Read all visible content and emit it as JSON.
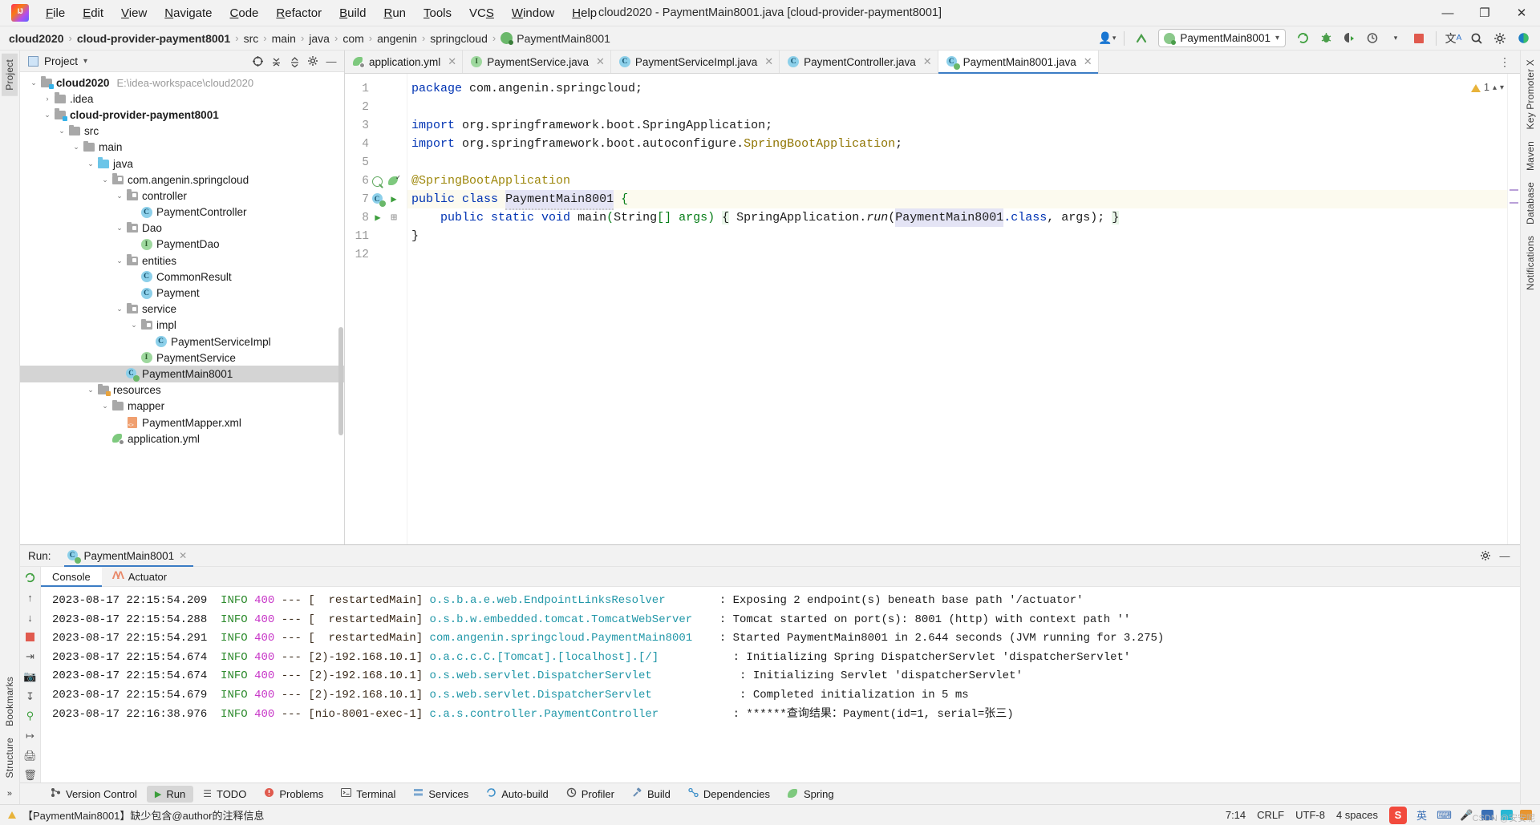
{
  "titlebar": {
    "logo": "intellij-idea-logo",
    "window_title": "cloud2020 - PaymentMain8001.java [cloud-provider-payment8001]",
    "menus": [
      "File",
      "Edit",
      "View",
      "Navigate",
      "Code",
      "Refactor",
      "Build",
      "Run",
      "Tools",
      "VCS",
      "Window",
      "Help"
    ],
    "minimize": "—",
    "maximize": "❐",
    "close": "✕"
  },
  "navbar": {
    "crumbs": [
      {
        "label": "cloud2020",
        "bold": true,
        "icon": null
      },
      {
        "label": "cloud-provider-payment8001",
        "bold": true,
        "icon": null
      },
      {
        "label": "src",
        "bold": false,
        "icon": null
      },
      {
        "label": "main",
        "bold": false,
        "icon": null
      },
      {
        "label": "java",
        "bold": false,
        "icon": null
      },
      {
        "label": "com",
        "bold": false,
        "icon": null
      },
      {
        "label": "angenin",
        "bold": false,
        "icon": null
      },
      {
        "label": "springcloud",
        "bold": false,
        "icon": null
      },
      {
        "label": "PaymentMain8001",
        "bold": false,
        "icon": "spring-class-icon"
      }
    ],
    "separator": "›",
    "run_config": "PaymentMain8001",
    "run_config_caret": "▾",
    "toolbar_icons": [
      "profile-user-icon",
      "chevron-down-icon",
      "up-arrow-icon",
      "rerun-icon",
      "debug-icon",
      "run-with-coverage-icon",
      "profiler-icon",
      "chevron-down-icon",
      "stop-icon",
      "translate-icon",
      "search-icon",
      "settings-gear-icon",
      "theme-icon"
    ]
  },
  "left_strip": [
    {
      "label": "Project",
      "selected": true
    },
    {
      "label": "Bookmarks",
      "selected": false
    },
    {
      "label": "Structure",
      "selected": false
    }
  ],
  "right_strip": [
    {
      "label": "Key Promoter X"
    },
    {
      "label": "Maven"
    },
    {
      "label": "Database"
    },
    {
      "label": "Notifications"
    }
  ],
  "project": {
    "title": "Project",
    "caret": "▾",
    "header_icons": [
      "locate-icon",
      "collapse-all-icon",
      "expand-all-icon",
      "settings-gear-icon",
      "hide-icon"
    ],
    "tree": [
      {
        "depth": 0,
        "arrow": "⌄",
        "icon": "module-folder-icon",
        "label": "cloud2020",
        "bold": true,
        "path": "E:\\idea-workspace\\cloud2020",
        "selected": false
      },
      {
        "depth": 1,
        "arrow": "›",
        "icon": "folder-icon",
        "label": ".idea",
        "bold": false,
        "path": "",
        "selected": false
      },
      {
        "depth": 1,
        "arrow": "⌄",
        "icon": "module-folder-icon",
        "label": "cloud-provider-payment8001",
        "bold": true,
        "path": "",
        "selected": false
      },
      {
        "depth": 2,
        "arrow": "⌄",
        "icon": "folder-icon",
        "label": "src",
        "bold": false,
        "path": "",
        "selected": false
      },
      {
        "depth": 3,
        "arrow": "⌄",
        "icon": "folder-icon",
        "label": "main",
        "bold": false,
        "path": "",
        "selected": false
      },
      {
        "depth": 4,
        "arrow": "⌄",
        "icon": "source-folder-icon",
        "label": "java",
        "bold": false,
        "path": "",
        "selected": false
      },
      {
        "depth": 5,
        "arrow": "⌄",
        "icon": "package-icon",
        "label": "com.angenin.springcloud",
        "bold": false,
        "path": "",
        "selected": false
      },
      {
        "depth": 6,
        "arrow": "⌄",
        "icon": "package-icon",
        "label": "controller",
        "bold": false,
        "path": "",
        "selected": false
      },
      {
        "depth": 7,
        "arrow": "",
        "icon": "java-class-icon",
        "label": "PaymentController",
        "bold": false,
        "path": "",
        "selected": false
      },
      {
        "depth": 6,
        "arrow": "⌄",
        "icon": "package-icon",
        "label": "Dao",
        "bold": false,
        "path": "",
        "selected": false
      },
      {
        "depth": 7,
        "arrow": "",
        "icon": "java-interface-icon",
        "label": "PaymentDao",
        "bold": false,
        "path": "",
        "selected": false
      },
      {
        "depth": 6,
        "arrow": "⌄",
        "icon": "package-icon",
        "label": "entities",
        "bold": false,
        "path": "",
        "selected": false
      },
      {
        "depth": 7,
        "arrow": "",
        "icon": "java-class-icon",
        "label": "CommonResult",
        "bold": false,
        "path": "",
        "selected": false
      },
      {
        "depth": 7,
        "arrow": "",
        "icon": "java-class-icon",
        "label": "Payment",
        "bold": false,
        "path": "",
        "selected": false
      },
      {
        "depth": 6,
        "arrow": "⌄",
        "icon": "package-icon",
        "label": "service",
        "bold": false,
        "path": "",
        "selected": false
      },
      {
        "depth": 7,
        "arrow": "⌄",
        "icon": "package-icon",
        "label": "impl",
        "bold": false,
        "path": "",
        "selected": false
      },
      {
        "depth": 8,
        "arrow": "",
        "icon": "java-class-icon",
        "label": "PaymentServiceImpl",
        "bold": false,
        "path": "",
        "selected": false
      },
      {
        "depth": 7,
        "arrow": "",
        "icon": "java-interface-icon",
        "label": "PaymentService",
        "bold": false,
        "path": "",
        "selected": false
      },
      {
        "depth": 6,
        "arrow": "",
        "icon": "spring-class-icon",
        "label": "PaymentMain8001",
        "bold": false,
        "path": "",
        "selected": true
      },
      {
        "depth": 4,
        "arrow": "⌄",
        "icon": "resource-folder-icon",
        "label": "resources",
        "bold": false,
        "path": "",
        "selected": false
      },
      {
        "depth": 5,
        "arrow": "⌄",
        "icon": "folder-icon",
        "label": "mapper",
        "bold": false,
        "path": "",
        "selected": false
      },
      {
        "depth": 6,
        "arrow": "",
        "icon": "xml-file-icon",
        "label": "PaymentMapper.xml",
        "bold": false,
        "path": "",
        "selected": false
      },
      {
        "depth": 5,
        "arrow": "",
        "icon": "yaml-spring-icon",
        "label": "application.yml",
        "bold": false,
        "path": "",
        "selected": false
      }
    ]
  },
  "editor": {
    "tabs": [
      {
        "label": "application.yml",
        "icon": "yaml-spring-icon",
        "active": false,
        "close": "✕"
      },
      {
        "label": "PaymentService.java",
        "icon": "java-interface-icon",
        "active": false,
        "close": "✕"
      },
      {
        "label": "PaymentServiceImpl.java",
        "icon": "java-class-icon",
        "active": false,
        "close": "✕"
      },
      {
        "label": "PaymentController.java",
        "icon": "java-class-icon",
        "active": false,
        "close": "✕"
      },
      {
        "label": "PaymentMain8001.java",
        "icon": "spring-class-icon",
        "active": true,
        "close": "✕"
      }
    ],
    "tabbar_more": "⋮",
    "warning_count": "1",
    "inspection_icons": [
      "warning-triangle-icon",
      "chevron-up-icon",
      "chevron-down-icon"
    ],
    "lines": [
      {
        "num": "1",
        "gutter": [],
        "fold": "",
        "highlight": false
      },
      {
        "num": "2",
        "gutter": [],
        "fold": "",
        "highlight": false
      },
      {
        "num": "3",
        "gutter": [],
        "fold": "import-fold",
        "highlight": false
      },
      {
        "num": "4",
        "gutter": [],
        "fold": "import-fold-end",
        "highlight": false
      },
      {
        "num": "5",
        "gutter": [],
        "fold": "",
        "highlight": false
      },
      {
        "num": "6",
        "gutter": [
          "spring-bean-icon",
          "spring-leaf-check-icon"
        ],
        "fold": "",
        "highlight": false
      },
      {
        "num": "7",
        "gutter": [
          "spring-class-icon",
          "run-arrow-icon"
        ],
        "fold": "",
        "highlight": true
      },
      {
        "num": "8",
        "gutter": [
          "run-arrow-icon"
        ],
        "fold": "method-fold",
        "highlight": false
      },
      {
        "num": "11",
        "gutter": [],
        "fold": "",
        "highlight": false
      },
      {
        "num": "12",
        "gutter": [],
        "fold": "",
        "highlight": false
      }
    ],
    "code": {
      "line1_kw": "package",
      "line1_rest": " com.angenin.springcloud;",
      "line3_kw": "import",
      "line3_rest": " org.springframework.boot.SpringApplication;",
      "line4_kw": "import",
      "line4_mid": " org.springframework.boot.autoconfigure.",
      "line4_cls": "SpringBootApplication",
      "line4_end": ";",
      "line6_ann": "@SpringBootApplication",
      "line7_kw1": "public",
      "line7_kw2": "class",
      "line7_name": "PaymentMain8001",
      "line7_brace": "{",
      "line8_kw": "public static void",
      "line8_main": "main",
      "line8_p1": "(",
      "line8_type": "String",
      "line8_p2": "[] args)",
      "line8_brace1": "{",
      "line8_app": "SpringApplication.",
      "line8_run": "run",
      "line8_p3": "(",
      "line8_arg": "PaymentMain8001",
      "line8_cls": ".class",
      "line8_p4": ", args);",
      "line8_brace2": "}",
      "line11_brace": "}"
    }
  },
  "run_panel": {
    "label": "Run:",
    "tab_title": "PaymentMain8001",
    "tab_close": "✕",
    "tab_icon": "spring-run-icon",
    "header_icons": [
      "settings-gear-icon",
      "hide-icon"
    ],
    "sidebar_icons": [
      "rerun-icon",
      "scroll-up-icon",
      "scroll-down-icon",
      "stop-icon",
      "soft-wrap-icon",
      "camera-icon",
      "scroll-end-icon",
      "thread-dump-icon",
      "export-icon",
      "print-icon",
      "trash-icon"
    ],
    "subtabs": [
      {
        "label": "Console",
        "icon": null,
        "active": true
      },
      {
        "label": "Actuator",
        "icon": "actuator-icon",
        "active": false
      }
    ],
    "logs": [
      {
        "ts": "2023-08-17 22:15:54.209",
        "level": "INFO",
        "pid": "400",
        "dash": "---",
        "thread": "[  restartedMain]",
        "logger": "o.s.b.a.e.web.EndpointLinksResolver",
        "msg": ": Exposing 2 endpoint(s) beneath base path '/actuator'"
      },
      {
        "ts": "2023-08-17 22:15:54.288",
        "level": "INFO",
        "pid": "400",
        "dash": "---",
        "thread": "[  restartedMain]",
        "logger": "o.s.b.w.embedded.tomcat.TomcatWebServer",
        "msg": ": Tomcat started on port(s): 8001 (http) with context path ''"
      },
      {
        "ts": "2023-08-17 22:15:54.291",
        "level": "INFO",
        "pid": "400",
        "dash": "---",
        "thread": "[  restartedMain]",
        "logger": "com.angenin.springcloud.PaymentMain8001",
        "msg": ": Started PaymentMain8001 in 2.644 seconds (JVM running for 3.275)"
      },
      {
        "ts": "2023-08-17 22:15:54.674",
        "level": "INFO",
        "pid": "400",
        "dash": "---",
        "thread": "[2)-192.168.10.1]",
        "logger": "o.a.c.c.C.[Tomcat].[localhost].[/]",
        "msg": ": Initializing Spring DispatcherServlet 'dispatcherServlet'"
      },
      {
        "ts": "2023-08-17 22:15:54.674",
        "level": "INFO",
        "pid": "400",
        "dash": "---",
        "thread": "[2)-192.168.10.1]",
        "logger": "o.s.web.servlet.DispatcherServlet",
        "msg": ": Initializing Servlet 'dispatcherServlet'"
      },
      {
        "ts": "2023-08-17 22:15:54.679",
        "level": "INFO",
        "pid": "400",
        "dash": "---",
        "thread": "[2)-192.168.10.1]",
        "logger": "o.s.web.servlet.DispatcherServlet",
        "msg": ": Completed initialization in 5 ms"
      },
      {
        "ts": "2023-08-17 22:16:38.976",
        "level": "INFO",
        "pid": "400",
        "dash": "---",
        "thread": "[nio-8001-exec-1]",
        "logger": "c.a.s.controller.PaymentController",
        "msg": ": ******查询结果：Payment(id=1, serial=张三)"
      }
    ]
  },
  "bottom_tools": [
    {
      "label": "Version Control",
      "icon": "branch-icon",
      "selected": false
    },
    {
      "label": "Run",
      "icon": "run-arrow-icon",
      "selected": true
    },
    {
      "label": "TODO",
      "icon": "todo-icon",
      "selected": false
    },
    {
      "label": "Problems",
      "icon": "problems-icon",
      "selected": false
    },
    {
      "label": "Terminal",
      "icon": "terminal-icon",
      "selected": false
    },
    {
      "label": "Services",
      "icon": "services-icon",
      "selected": false
    },
    {
      "label": "Auto-build",
      "icon": "autobuild-icon",
      "selected": false
    },
    {
      "label": "Profiler",
      "icon": "profiler-icon",
      "selected": false
    },
    {
      "label": "Build",
      "icon": "build-hammer-icon",
      "selected": false
    },
    {
      "label": "Dependencies",
      "icon": "dependencies-icon",
      "selected": false
    },
    {
      "label": "Spring",
      "icon": "spring-leaf-icon",
      "selected": false
    }
  ],
  "statusbar": {
    "message": "【PaymentMain8001】缺少包含@author的注释信息",
    "warn_icon": "warning-triangle-icon",
    "caret_position": "7:14",
    "line_separator": "CRLF",
    "encoding": "UTF-8",
    "indent": "4 spaces",
    "ime_label": "英",
    "ime_icons": [
      "sogou-icon",
      "keyboard-icon",
      "mic-icon",
      "panel-icon",
      "blue-square-icon",
      "orange-square-icon"
    ],
    "watermark": "CSDN @安安呢"
  }
}
